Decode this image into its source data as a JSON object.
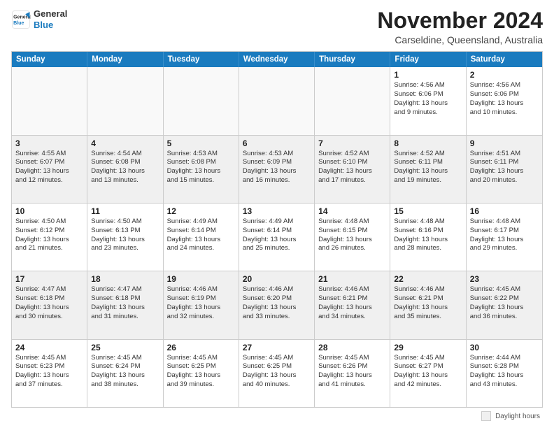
{
  "logo": {
    "line1": "General",
    "line2": "Blue"
  },
  "title": "November 2024",
  "location": "Carseldine, Queensland, Australia",
  "weekdays": [
    "Sunday",
    "Monday",
    "Tuesday",
    "Wednesday",
    "Thursday",
    "Friday",
    "Saturday"
  ],
  "rows": [
    [
      {
        "day": "",
        "text": "",
        "empty": true
      },
      {
        "day": "",
        "text": "",
        "empty": true
      },
      {
        "day": "",
        "text": "",
        "empty": true
      },
      {
        "day": "",
        "text": "",
        "empty": true
      },
      {
        "day": "",
        "text": "",
        "empty": true
      },
      {
        "day": "1",
        "text": "Sunrise: 4:56 AM\nSunset: 6:06 PM\nDaylight: 13 hours\nand 9 minutes.",
        "empty": false
      },
      {
        "day": "2",
        "text": "Sunrise: 4:56 AM\nSunset: 6:06 PM\nDaylight: 13 hours\nand 10 minutes.",
        "empty": false
      }
    ],
    [
      {
        "day": "3",
        "text": "Sunrise: 4:55 AM\nSunset: 6:07 PM\nDaylight: 13 hours\nand 12 minutes.",
        "empty": false
      },
      {
        "day": "4",
        "text": "Sunrise: 4:54 AM\nSunset: 6:08 PM\nDaylight: 13 hours\nand 13 minutes.",
        "empty": false
      },
      {
        "day": "5",
        "text": "Sunrise: 4:53 AM\nSunset: 6:08 PM\nDaylight: 13 hours\nand 15 minutes.",
        "empty": false
      },
      {
        "day": "6",
        "text": "Sunrise: 4:53 AM\nSunset: 6:09 PM\nDaylight: 13 hours\nand 16 minutes.",
        "empty": false
      },
      {
        "day": "7",
        "text": "Sunrise: 4:52 AM\nSunset: 6:10 PM\nDaylight: 13 hours\nand 17 minutes.",
        "empty": false
      },
      {
        "day": "8",
        "text": "Sunrise: 4:52 AM\nSunset: 6:11 PM\nDaylight: 13 hours\nand 19 minutes.",
        "empty": false
      },
      {
        "day": "9",
        "text": "Sunrise: 4:51 AM\nSunset: 6:11 PM\nDaylight: 13 hours\nand 20 minutes.",
        "empty": false
      }
    ],
    [
      {
        "day": "10",
        "text": "Sunrise: 4:50 AM\nSunset: 6:12 PM\nDaylight: 13 hours\nand 21 minutes.",
        "empty": false
      },
      {
        "day": "11",
        "text": "Sunrise: 4:50 AM\nSunset: 6:13 PM\nDaylight: 13 hours\nand 23 minutes.",
        "empty": false
      },
      {
        "day": "12",
        "text": "Sunrise: 4:49 AM\nSunset: 6:14 PM\nDaylight: 13 hours\nand 24 minutes.",
        "empty": false
      },
      {
        "day": "13",
        "text": "Sunrise: 4:49 AM\nSunset: 6:14 PM\nDaylight: 13 hours\nand 25 minutes.",
        "empty": false
      },
      {
        "day": "14",
        "text": "Sunrise: 4:48 AM\nSunset: 6:15 PM\nDaylight: 13 hours\nand 26 minutes.",
        "empty": false
      },
      {
        "day": "15",
        "text": "Sunrise: 4:48 AM\nSunset: 6:16 PM\nDaylight: 13 hours\nand 28 minutes.",
        "empty": false
      },
      {
        "day": "16",
        "text": "Sunrise: 4:48 AM\nSunset: 6:17 PM\nDaylight: 13 hours\nand 29 minutes.",
        "empty": false
      }
    ],
    [
      {
        "day": "17",
        "text": "Sunrise: 4:47 AM\nSunset: 6:18 PM\nDaylight: 13 hours\nand 30 minutes.",
        "empty": false
      },
      {
        "day": "18",
        "text": "Sunrise: 4:47 AM\nSunset: 6:18 PM\nDaylight: 13 hours\nand 31 minutes.",
        "empty": false
      },
      {
        "day": "19",
        "text": "Sunrise: 4:46 AM\nSunset: 6:19 PM\nDaylight: 13 hours\nand 32 minutes.",
        "empty": false
      },
      {
        "day": "20",
        "text": "Sunrise: 4:46 AM\nSunset: 6:20 PM\nDaylight: 13 hours\nand 33 minutes.",
        "empty": false
      },
      {
        "day": "21",
        "text": "Sunrise: 4:46 AM\nSunset: 6:21 PM\nDaylight: 13 hours\nand 34 minutes.",
        "empty": false
      },
      {
        "day": "22",
        "text": "Sunrise: 4:46 AM\nSunset: 6:21 PM\nDaylight: 13 hours\nand 35 minutes.",
        "empty": false
      },
      {
        "day": "23",
        "text": "Sunrise: 4:45 AM\nSunset: 6:22 PM\nDaylight: 13 hours\nand 36 minutes.",
        "empty": false
      }
    ],
    [
      {
        "day": "24",
        "text": "Sunrise: 4:45 AM\nSunset: 6:23 PM\nDaylight: 13 hours\nand 37 minutes.",
        "empty": false
      },
      {
        "day": "25",
        "text": "Sunrise: 4:45 AM\nSunset: 6:24 PM\nDaylight: 13 hours\nand 38 minutes.",
        "empty": false
      },
      {
        "day": "26",
        "text": "Sunrise: 4:45 AM\nSunset: 6:25 PM\nDaylight: 13 hours\nand 39 minutes.",
        "empty": false
      },
      {
        "day": "27",
        "text": "Sunrise: 4:45 AM\nSunset: 6:25 PM\nDaylight: 13 hours\nand 40 minutes.",
        "empty": false
      },
      {
        "day": "28",
        "text": "Sunrise: 4:45 AM\nSunset: 6:26 PM\nDaylight: 13 hours\nand 41 minutes.",
        "empty": false
      },
      {
        "day": "29",
        "text": "Sunrise: 4:45 AM\nSunset: 6:27 PM\nDaylight: 13 hours\nand 42 minutes.",
        "empty": false
      },
      {
        "day": "30",
        "text": "Sunrise: 4:44 AM\nSunset: 6:28 PM\nDaylight: 13 hours\nand 43 minutes.",
        "empty": false
      }
    ]
  ],
  "footer": {
    "legend_label": "Daylight hours"
  }
}
